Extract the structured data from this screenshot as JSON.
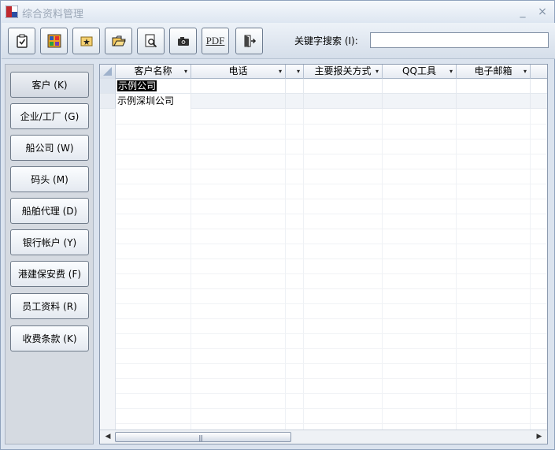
{
  "window": {
    "title": "综合资料管理",
    "minimize_label": "_",
    "close_label": "×"
  },
  "toolbar": {
    "buttons": [
      {
        "name": "confirm",
        "icon": "clipboard-check-icon"
      },
      {
        "name": "grid",
        "icon": "grid-color-icon"
      },
      {
        "name": "new",
        "icon": "new-folder-star-icon"
      },
      {
        "name": "open",
        "icon": "open-folder-icon"
      },
      {
        "name": "preview",
        "icon": "print-preview-icon"
      },
      {
        "name": "camera",
        "icon": "camera-icon"
      },
      {
        "name": "pdf",
        "label": "PDF"
      },
      {
        "name": "exit",
        "icon": "exit-door-icon"
      }
    ],
    "search_label": "关键字搜索 (I):",
    "search_value": ""
  },
  "sidebar": {
    "items": [
      {
        "label": "客户 (K)",
        "active": true
      },
      {
        "label": "企业/工厂 (G)"
      },
      {
        "label": "船公司 (W)"
      },
      {
        "label": "码头 (M)"
      },
      {
        "label": "船舶代理 (D)"
      },
      {
        "label": "银行帐户 (Y)"
      },
      {
        "label": "港建保安费 (F)"
      },
      {
        "label": "员工资料 (R)"
      },
      {
        "label": "收费条款 (K)"
      }
    ]
  },
  "grid": {
    "columns": [
      "客户名称",
      "电话",
      "",
      "主要报关方式",
      "QQ工具",
      "电子邮箱"
    ],
    "rows": [
      [
        "示例公司",
        "",
        "",
        "",
        "",
        ""
      ],
      [
        "示例深圳公司",
        "",
        "",
        "",
        "",
        ""
      ]
    ],
    "dropdown_glyph": "▾",
    "scroll_left": "◀",
    "scroll_right": "▶",
    "thumb_grip": "|||"
  },
  "colors": {
    "window_bg": "#dbe3ee",
    "title_text": "#9aa6b6",
    "selection": "#000000"
  }
}
